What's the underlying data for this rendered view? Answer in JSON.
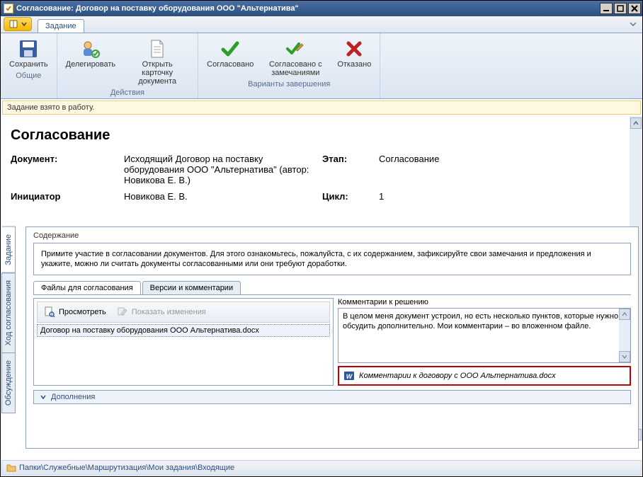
{
  "window": {
    "title": "Согласование: Договор на поставку оборудования ООО \"Альтернатива\""
  },
  "tabs": {
    "task": "Задание"
  },
  "ribbon": {
    "save": "Сохранить",
    "delegate": "Делегировать",
    "open_card": "Открыть карточку документа",
    "approved": "Согласовано",
    "approved_notes": "Согласовано с замечаниями",
    "rejected": "Отказано",
    "group_general": "Общие",
    "group_actions": "Действия",
    "group_completion": "Варианты завершения"
  },
  "status": "Задание взято в работу.",
  "header": {
    "title": "Согласование",
    "doc_label": "Документ:",
    "doc_value": "Исходящий Договор на поставку оборудования ООО \"Альтернатива\" (автор: Новикова Е. В.)",
    "stage_label": "Этап:",
    "stage_value": "Согласование",
    "initiator_label": "Инициатор",
    "initiator_value": "Новикова Е. В.",
    "cycle_label": "Цикл:",
    "cycle_value": "1"
  },
  "vtabs": {
    "task": "Задание",
    "flow": "Ход согласования",
    "discussion": "Обсуждение"
  },
  "content": {
    "section_label": "Содержание",
    "instruction": "Примите участие в согласовании документов. Для этого ознакомьтесь, пожалуйста, с их содержанием, зафиксируйте свои замечания и предложения и укажите, можно ли считать документы согласованными или они требуют доработки.",
    "files_tab": "Файлы для согласования",
    "versions_tab": "Версии и комментарии",
    "preview": "Просмотреть",
    "show_changes": "Показать изменения",
    "file_name": "Договор на поставку оборудования ООО Альтернатива.docx",
    "comments_label": "Комментарии к решению",
    "comments_text": "В целом меня документ устроил, но есть несколько пунктов, которые нужно обсудить дополнительно. Мои комментарии – во вложенном файле.",
    "attachment": "Комментарии к договору с ООО Альтернатива.docx",
    "additions": "Дополнения"
  },
  "footer": {
    "breadcrumb": "Папки\\Служебные\\Маршрутизация\\Мои задания\\Входящие"
  }
}
